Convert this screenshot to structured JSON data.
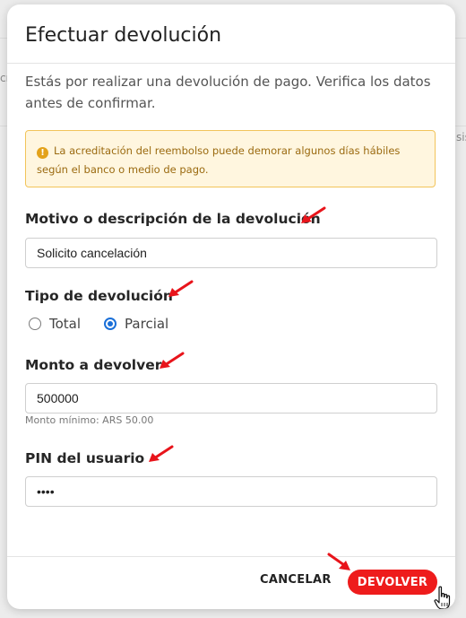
{
  "background": {
    "fragments": [
      "cr",
      "sis"
    ]
  },
  "modal": {
    "title": "Efectuar devolución",
    "intro": "Estás por realizar una devolución de pago. Verifica los datos antes de confirmar.",
    "alert": {
      "icon": "info-icon",
      "text": "La acreditación del reembolso puede demorar algunos días hábiles según el banco o medio de pago."
    },
    "reason": {
      "label": "Motivo o descripción de la devolución",
      "value": "Solicito cancelación"
    },
    "refund_type": {
      "label": "Tipo de devolución",
      "options": [
        "Total",
        "Parcial"
      ],
      "selected": "Parcial"
    },
    "amount": {
      "label": "Monto a devolver",
      "value": "500000",
      "hint": "Monto mínimo: ARS 50.00"
    },
    "pin": {
      "label": "PIN del usuario",
      "value": "••••"
    },
    "actions": {
      "cancel_label": "CANCELAR",
      "confirm_label": "DEVOLVER"
    }
  },
  "colors": {
    "primary_button": "#ee1c1c",
    "radio_accent": "#1a6fd8",
    "alert_background": "#fff6df",
    "alert_border": "#f2c45a",
    "annotation_arrow": "#e8141b"
  }
}
